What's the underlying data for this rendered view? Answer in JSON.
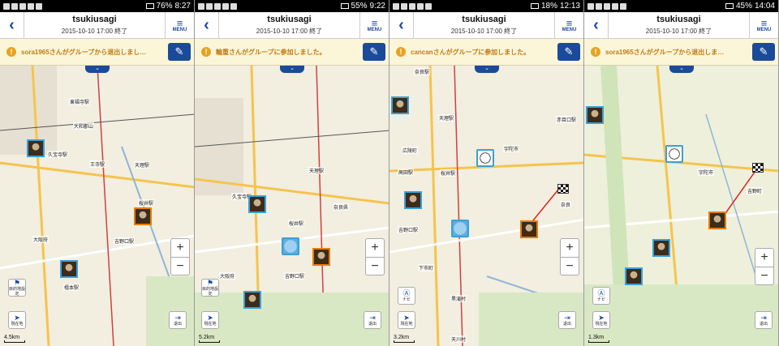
{
  "panels": [
    {
      "status": {
        "time": "8:27",
        "battery": "76%"
      },
      "header": {
        "title": "tsukiusagi",
        "subtitle": "2015-10-10 17:00 終了",
        "menu_label": "MENU"
      },
      "notice": "sora1965さんがグループから退出しまし…",
      "stations": [
        "大阪府",
        "久宝寺駅",
        "王寺駅",
        "天理駅",
        "桜井駅",
        "吉野口駅",
        "橿本駅",
        "東福寺駅",
        "大和郡山"
      ],
      "left_button": {
        "icon": "flag-icon",
        "label": "目的地設定"
      },
      "location_button": "現在地",
      "exit_button": "退出",
      "scale": "4.5km"
    },
    {
      "status": {
        "time": "9:22",
        "battery": "55%"
      },
      "header": {
        "title": "tsukiusagi",
        "subtitle": "2015-10-10 17:00 終了",
        "menu_label": "MENU"
      },
      "notice": "輪重さんがグループに参加しました。",
      "stations": [
        "大阪府",
        "久宝寺駅",
        "天理駅",
        "桜井駅",
        "奈良県",
        "吉野口駅"
      ],
      "left_button": {
        "icon": "flag-icon",
        "label": "目的地設定"
      },
      "location_button": "現在地",
      "exit_button": "退出",
      "scale": "5.2km"
    },
    {
      "status": {
        "time": "12:13",
        "battery": "18%"
      },
      "header": {
        "title": "tsukiusagi",
        "subtitle": "2015-10-10 17:00 終了",
        "menu_label": "MENU"
      },
      "notice": "cancanさんがグループに参加しました。",
      "stations": [
        "奈良駅",
        "天理駅",
        "広陵町",
        "高田駅",
        "桜井駅",
        "吉野口駅",
        "宇陀市",
        "赤目口駅",
        "奈良",
        "黒滝村",
        "下市町",
        "天川村"
      ],
      "left_button": {
        "icon": "navi-icon",
        "label": "ナビ"
      },
      "location_button": "現在地",
      "exit_button": "退出",
      "scale": "3.2km"
    },
    {
      "status": {
        "time": "14:04",
        "battery": "45%"
      },
      "header": {
        "title": "tsukiusagi",
        "subtitle": "2015-10-10 17:00 終了",
        "menu_label": "MENU"
      },
      "notice": "sora1965さんがグループから退出しま…",
      "stations": [
        "宇陀市",
        "吉野町"
      ],
      "left_button": {
        "icon": "navi-icon",
        "label": "ナビ"
      },
      "location_button": "現在地",
      "exit_button": "退出",
      "scale": "1.3km"
    }
  ]
}
